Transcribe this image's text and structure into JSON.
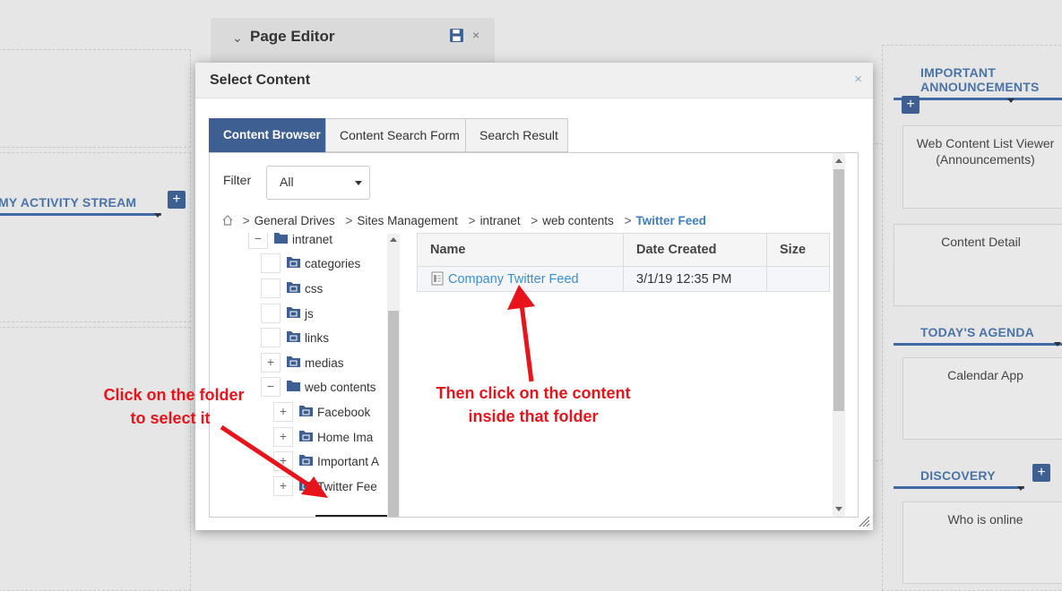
{
  "background": {
    "page_editor": {
      "title": "Page Editor"
    },
    "portlets": {
      "activity_stream": "MY ACTIVITY STREAM",
      "announcements": "IMPORTANT ANNOUNCEMENTS",
      "announcements_box": "Web Content List Viewer (Announcements)",
      "content_detail": "Content Detail",
      "agenda": "TODAY'S AGENDA",
      "calendar_app": "Calendar App",
      "discovery": "DISCOVERY",
      "who_is_online": "Who is online"
    },
    "plus_symbol": "+"
  },
  "modal": {
    "title": "Select Content",
    "close_symbol": "×",
    "tabs": [
      {
        "label": "Content Browser",
        "active": true
      },
      {
        "label": "Content Search Form",
        "active": false
      },
      {
        "label": "Search Result",
        "active": false
      }
    ],
    "filter": {
      "label": "Filter",
      "value": "All"
    },
    "breadcrumb": [
      "General Drives",
      "Sites Management",
      "intranet",
      "web contents",
      "Twitter Feed"
    ],
    "breadcrumb_separator": ">",
    "tree": [
      {
        "label": "intranet",
        "expander": "−",
        "icon": "open-folder-icon"
      },
      {
        "label": "categories",
        "expander": "",
        "icon": "folder-icon"
      },
      {
        "label": "css",
        "expander": "",
        "icon": "folder-icon"
      },
      {
        "label": "js",
        "expander": "",
        "icon": "folder-icon"
      },
      {
        "label": "links",
        "expander": "",
        "icon": "folder-icon"
      },
      {
        "label": "medias",
        "expander": "+",
        "icon": "folder-icon"
      },
      {
        "label": "web contents",
        "expander": "−",
        "icon": "open-folder-icon"
      },
      {
        "label": "Facebook",
        "expander": "+",
        "icon": "folder-icon"
      },
      {
        "label": "Home Ima",
        "expander": "+",
        "icon": "folder-icon"
      },
      {
        "label": "Important A",
        "expander": "+",
        "icon": "folder-icon"
      },
      {
        "label": "Twitter Fee",
        "expander": "+",
        "icon": "folder-icon"
      }
    ],
    "table": {
      "columns": [
        "Name",
        "Date Created",
        "Size"
      ],
      "rows": [
        {
          "name": "Company Twitter Feed",
          "date_created": "3/1/19 12:35 PM",
          "size": ""
        }
      ]
    }
  },
  "annotations": {
    "folder_hint_line1": "Click on the folder",
    "folder_hint_line2": "to select it",
    "content_hint_line1": "Then click on the content",
    "content_hint_line2": "inside that folder"
  },
  "colors": {
    "accent": "#3d5f92",
    "link": "#3d8ecb",
    "annotation": "#e8141b"
  }
}
